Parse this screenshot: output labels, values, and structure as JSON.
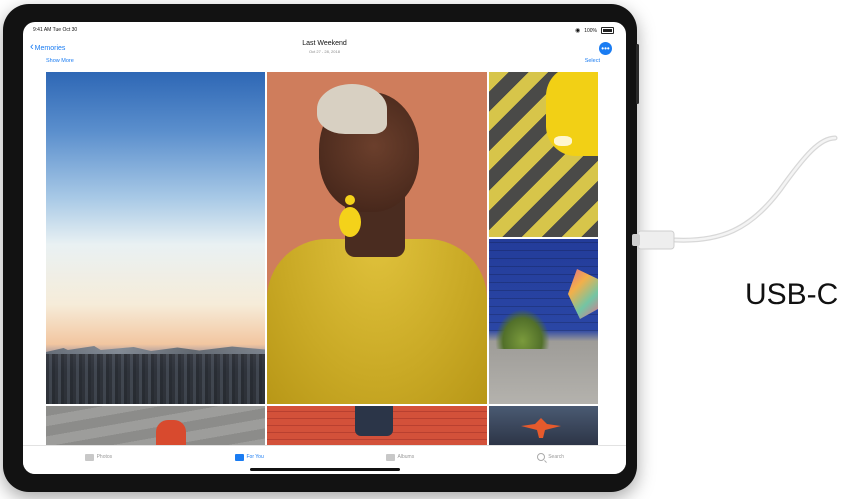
{
  "status_bar": {
    "time_date": "9:41 AM   Tue Oct 30",
    "battery": "100%"
  },
  "nav": {
    "back_label": "Memories",
    "title": "Last Weekend",
    "subtitle": "Oct 27 - 28, 2018",
    "show_more": "Show More",
    "select": "Select",
    "more_icon": "•••"
  },
  "photos": [
    "sky-city",
    "portrait",
    "taxi",
    "brick-wall",
    "stairs",
    "red-bricks",
    "dancer"
  ],
  "tabs": [
    {
      "label": "Photos",
      "icon": "photos-icon"
    },
    {
      "label": "For You",
      "icon": "for-you-icon"
    },
    {
      "label": "Albums",
      "icon": "albums-icon"
    },
    {
      "label": "Search",
      "icon": "search-icon"
    }
  ],
  "active_tab": "For You",
  "annotation": {
    "label": "USB-C"
  },
  "colors": {
    "accent": "#1a7cf2",
    "device": "#121212"
  }
}
